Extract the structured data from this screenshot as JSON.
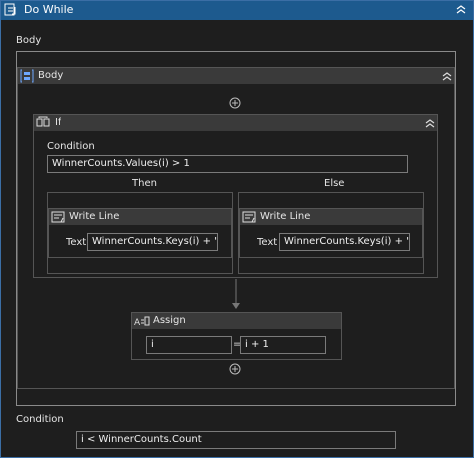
{
  "do_while": {
    "title": "Do While",
    "body_label": "Body",
    "condition_label": "Condition",
    "condition_value": "i < WinnerCounts.Count"
  },
  "body_sequence": {
    "title": "Body"
  },
  "if_activity": {
    "title": "If",
    "condition_label": "Condition",
    "condition_value": "WinnerCounts.Values(i) > 1",
    "then_label": "Then",
    "else_label": "Else"
  },
  "then_writeline": {
    "title": "Write Line",
    "text_label": "Text",
    "text_value": "WinnerCounts.Keys(i) + \" is g"
  },
  "else_writeline": {
    "title": "Write Line",
    "text_label": "Text",
    "text_value": "WinnerCounts.Keys(i) + \" is e"
  },
  "assign": {
    "title": "Assign",
    "to_value": "i",
    "equals": "=",
    "value": "i + 1"
  },
  "colors": {
    "title_bar": "#1d5a8e",
    "header_bar": "#3a3a3a",
    "background": "#1e1e1e",
    "border": "#8a8a8a"
  }
}
